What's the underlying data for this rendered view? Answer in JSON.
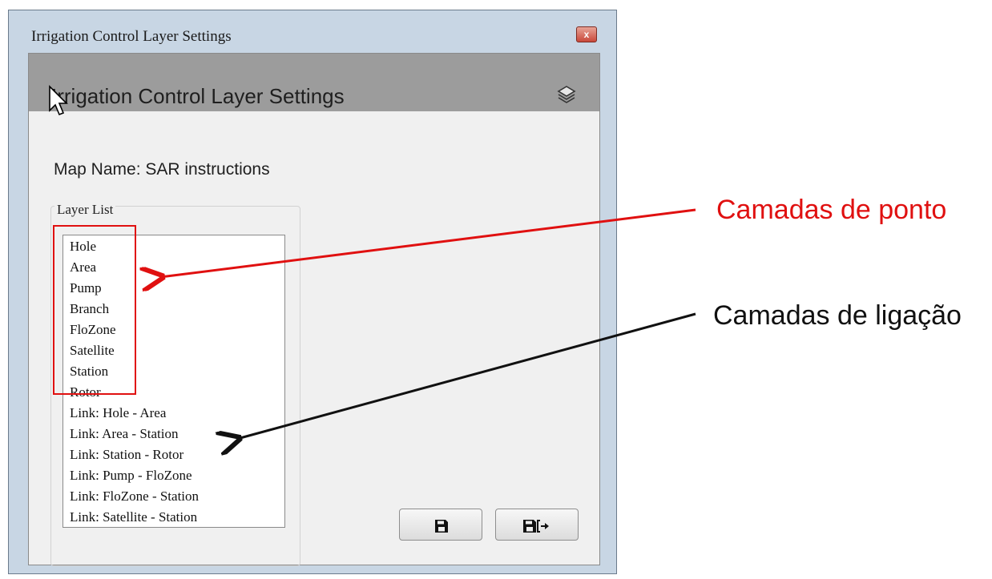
{
  "window": {
    "title": "Irrigation Control Layer Settings",
    "close_glyph": "x"
  },
  "header": {
    "title": "Irrigation Control Layer Settings",
    "icon": "layers-icon"
  },
  "map": {
    "label": "Map Name:  SAR instructions"
  },
  "layer_list": {
    "legend": "Layer List",
    "items": [
      "Hole",
      "Area",
      "Pump",
      "Branch",
      "FloZone",
      "Satellite",
      "Station",
      "Rotor",
      "Link: Hole - Area",
      "Link: Area - Station",
      "Link: Station - Rotor",
      "Link: Pump - FloZone",
      "Link: FloZone - Station",
      "Link: Satellite - Station"
    ]
  },
  "buttons": {
    "save_icon": "save-icon",
    "save_exit_icon": "save-exit-icon"
  },
  "annotations": {
    "point_layers": "Camadas de ponto",
    "link_layers": "Camadas de ligação",
    "point_color": "#e01010",
    "link_color": "#111111"
  }
}
